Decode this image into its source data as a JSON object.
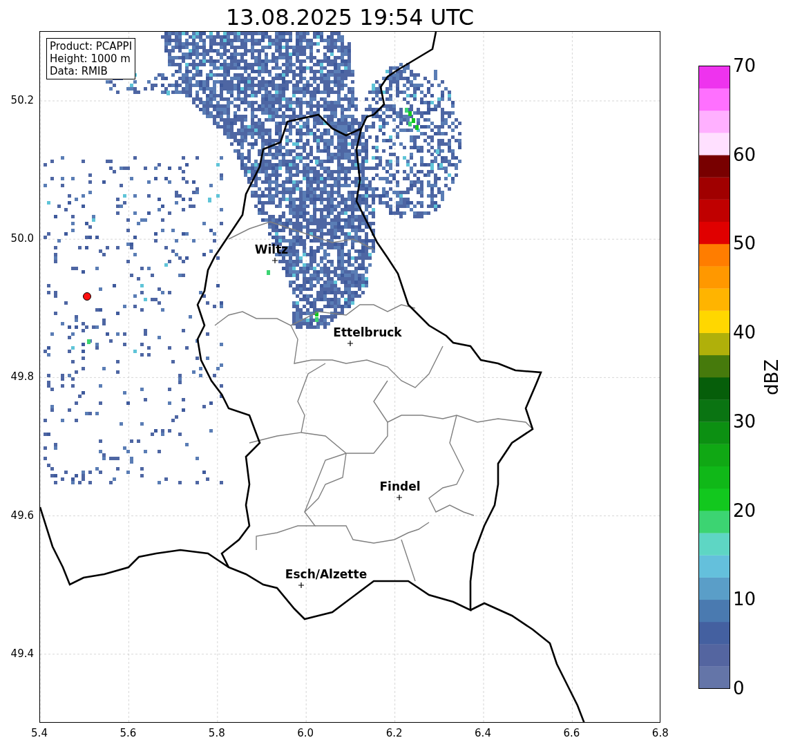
{
  "title": "13.08.2025 19:54 UTC",
  "info_box": [
    "Product: PCAPPI",
    "Height: 1000 m",
    "Data: RMIB"
  ],
  "map": {
    "x_ticks": [
      "5.4",
      "5.6",
      "5.8",
      "6.0",
      "6.2",
      "6.4",
      "6.6",
      "6.8"
    ],
    "y_ticks": [
      "50.2",
      "50.0",
      "49.8",
      "49.6",
      "49.4"
    ],
    "cities": [
      {
        "name": "Wiltz"
      },
      {
        "name": "Ettelbruck"
      },
      {
        "name": "Findel"
      },
      {
        "name": "Esch/Alzette"
      }
    ]
  },
  "colorbar": {
    "label": "dBZ",
    "ticks": [
      "70",
      "60",
      "50",
      "40",
      "30",
      "20",
      "10",
      "0"
    ],
    "bands": [
      {
        "color": "#6475a8"
      },
      {
        "color": "#5465a0"
      },
      {
        "color": "#4460a0"
      },
      {
        "color": "#4a7ab0"
      },
      {
        "color": "#5a9ec8"
      },
      {
        "color": "#64c0dc"
      },
      {
        "color": "#5ed6c4"
      },
      {
        "color": "#3cd472"
      },
      {
        "color": "#12c81e"
      },
      {
        "color": "#10b818"
      },
      {
        "color": "#10a814"
      },
      {
        "color": "#0c9012"
      },
      {
        "color": "#0a7412"
      },
      {
        "color": "#065e0a"
      },
      {
        "color": "#467a0c"
      },
      {
        "color": "#b0b00a"
      },
      {
        "color": "#ffd700"
      },
      {
        "color": "#ffb400"
      },
      {
        "color": "#ff9800"
      },
      {
        "color": "#ff7d00"
      },
      {
        "color": "#e00000"
      },
      {
        "color": "#c00000"
      },
      {
        "color": "#a00000"
      },
      {
        "color": "#780000"
      },
      {
        "color": "#ffe0ff"
      },
      {
        "color": "#ffb0ff"
      },
      {
        "color": "#ff70ff"
      },
      {
        "color": "#ee33ee"
      }
    ]
  }
}
